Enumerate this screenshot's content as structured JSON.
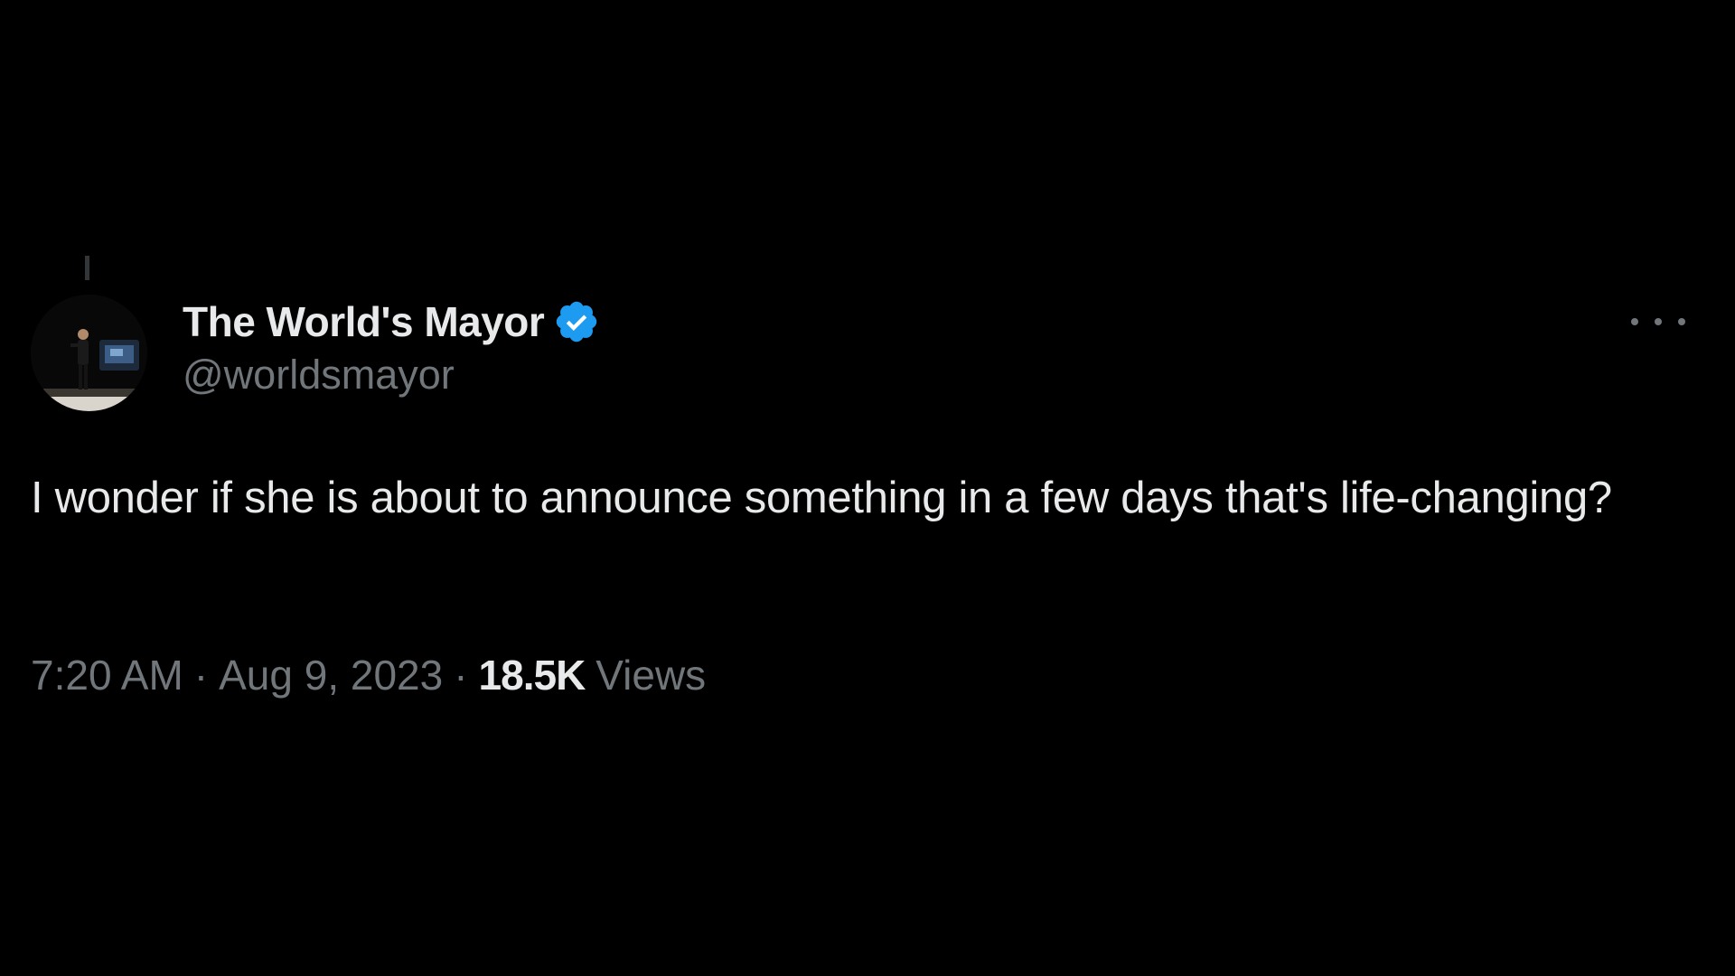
{
  "tweet": {
    "author": {
      "display_name": "The World's Mayor",
      "handle": "@worldsmayor",
      "verified": true,
      "avatar_icon": "profile-photo-person-on-stage"
    },
    "more_icon": "more-horizontal-icon",
    "text": "I wonder if she is about to announce something in a few days that's life-changing?",
    "meta": {
      "time": "7:20 AM",
      "separator": "·",
      "date": "Aug 9, 2023",
      "views_count": "18.5K",
      "views_label": "Views"
    }
  },
  "colors": {
    "background": "#000000",
    "primary_text": "#e7e9ea",
    "secondary_text": "#71767b",
    "verified_badge": "#1d9bf0"
  }
}
